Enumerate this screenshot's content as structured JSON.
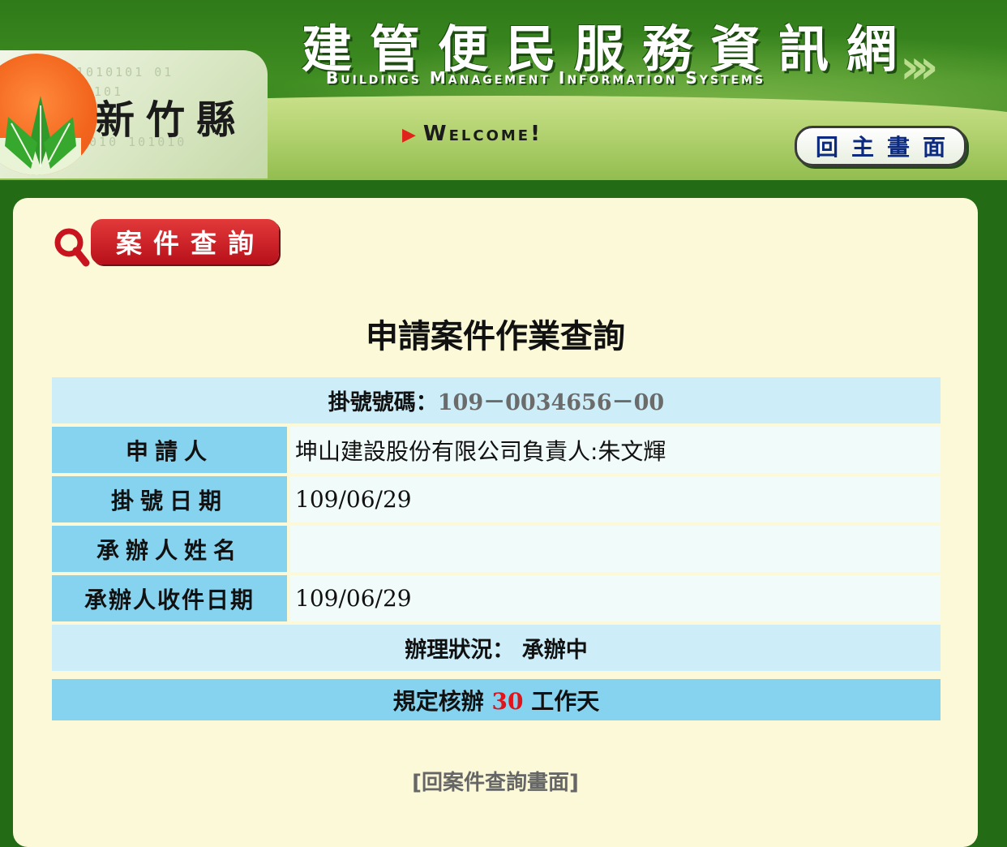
{
  "header": {
    "site_title": "建管便民服務資訊網",
    "site_subtitle": "Buildings Management Information Systems",
    "county": "新竹縣",
    "binary_1": "01010101 01",
    "binary_2": "0101",
    "binary_3": "1010  101010",
    "welcome": "Welcome!",
    "home_button": "回主畫面"
  },
  "section": {
    "badge": "案件查詢",
    "title": "申請案件作業查詢"
  },
  "record": {
    "reg_label": "掛號號碼：",
    "reg_number": "109－0034656－00",
    "rows": [
      {
        "label": "申請人",
        "value": "坤山建設股份有限公司負責人:朱文輝"
      },
      {
        "label": "掛號日期",
        "value": "109/06/29"
      },
      {
        "label": "承辦人姓名",
        "value": ""
      },
      {
        "label": "承辦人收件日期",
        "value": "109/06/29"
      }
    ],
    "status_label": "辦理狀況：",
    "status_value": "承辦中",
    "days_prefix": "規定核辦",
    "days_value": "30",
    "days_suffix": "工作天"
  },
  "back_link": "[回案件查詢畫面]",
  "colors": {
    "background": "#236b14",
    "content_bg": "#fbf9d8",
    "label_bg": "#86d3ef",
    "light_row_bg": "#cdeef9",
    "badge_red": "#c8141e"
  }
}
